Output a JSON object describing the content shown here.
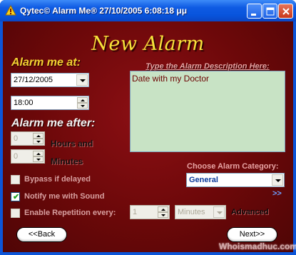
{
  "window": {
    "title": "Qytec© Alarm Me®  27/10/2005 6:08:18 μμ"
  },
  "heading": "New Alarm",
  "alarm_at": {
    "label": "Alarm me at:",
    "date_value": "27/12/2005",
    "time_value": "18:00"
  },
  "alarm_after": {
    "label": "Alarm me after:",
    "hours_value": "0",
    "hours_label": "Hours and",
    "minutes_value": "0",
    "minutes_label": "Minutes"
  },
  "description": {
    "label": "Type the Alarm Description Here:",
    "value": "Date with my Doctor"
  },
  "category": {
    "label": "Choose Alarm Category:",
    "selected": "General"
  },
  "chevron": ">>",
  "options": {
    "bypass_label": "Bypass if delayed",
    "bypass_checked": false,
    "sound_label": "Notify me with Sound",
    "sound_checked": true,
    "repeat_label": "Enable Repetition every:",
    "repeat_checked": false,
    "repeat_count": "1",
    "repeat_unit": "Minutes",
    "advanced_label": "Advanced"
  },
  "buttons": {
    "back": "<<Back",
    "next": "Next>>"
  },
  "watermark": "Whoismadhuc.com",
  "colors": {
    "title_bar": "#0854dc",
    "background": "#6b0809",
    "heading": "#f6e23a",
    "description_bg": "#c8e3c5"
  }
}
